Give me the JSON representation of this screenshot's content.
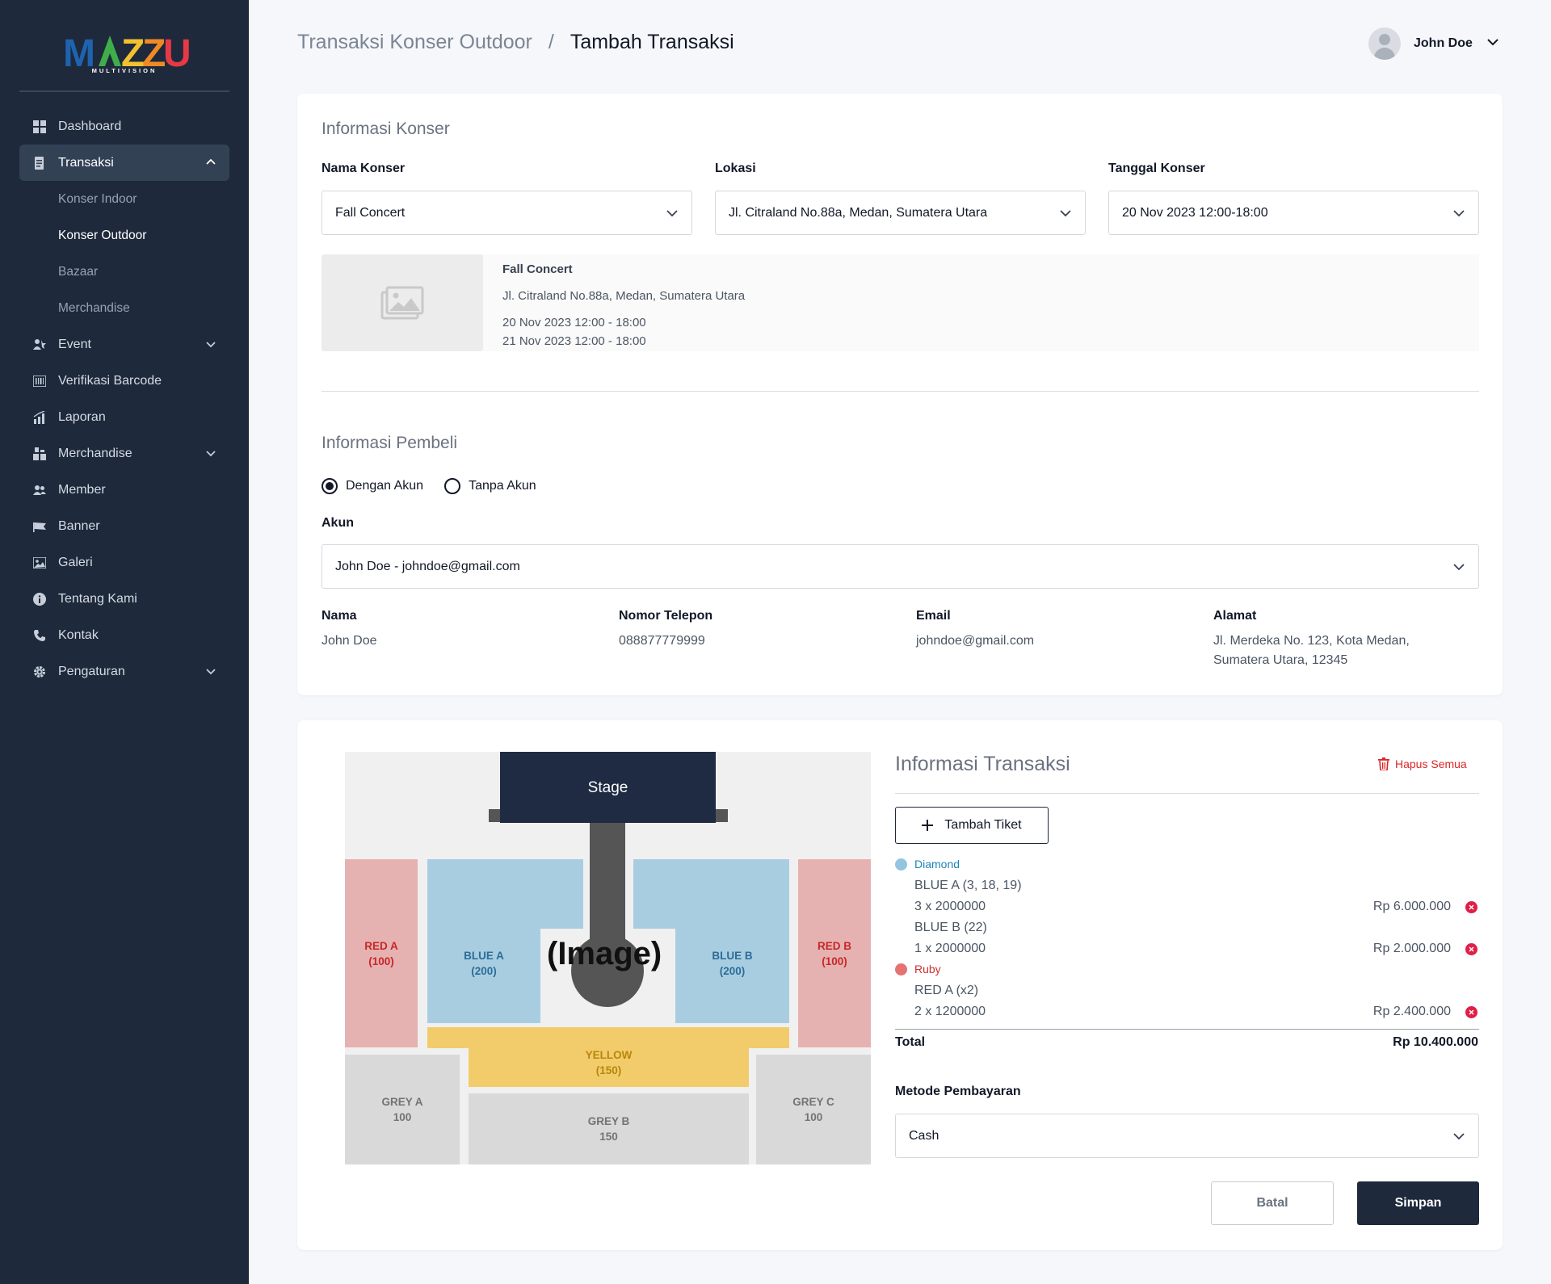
{
  "brand": {
    "logo_text": "MAZZU",
    "logo_sub": "MULTIVISION"
  },
  "sidebar": {
    "items": [
      {
        "label": "Dashboard",
        "icon": "dashboard-icon"
      },
      {
        "label": "Transaksi",
        "icon": "receipt-icon",
        "expanded": true,
        "children": [
          "Konser Indoor",
          "Konser Outdoor",
          "Bazaar",
          "Merchandise"
        ],
        "active_child": "Konser Outdoor"
      },
      {
        "label": "Event",
        "icon": "event-icon",
        "has_children": true
      },
      {
        "label": "Verifikasi Barcode",
        "icon": "barcode-icon"
      },
      {
        "label": "Laporan",
        "icon": "chart-icon"
      },
      {
        "label": "Merchandise",
        "icon": "shop-icon",
        "has_children": true
      },
      {
        "label": "Member",
        "icon": "users-icon"
      },
      {
        "label": "Banner",
        "icon": "flag-icon"
      },
      {
        "label": "Galeri",
        "icon": "gallery-icon"
      },
      {
        "label": "Tentang Kami",
        "icon": "info-icon"
      },
      {
        "label": "Kontak",
        "icon": "phone-icon"
      },
      {
        "label": "Pengaturan",
        "icon": "gear-icon",
        "has_children": true
      }
    ]
  },
  "header": {
    "breadcrumb_parent": "Transaksi Konser Outdoor",
    "breadcrumb_sep": "/",
    "breadcrumb_current": "Tambah Transaksi",
    "user_name": "John Doe"
  },
  "konser": {
    "section_title": "Informasi Konser",
    "nama_label": "Nama Konser",
    "nama_value": "Fall Concert",
    "lokasi_label": "Lokasi",
    "lokasi_value": "Jl. Citraland No.88a, Medan, Sumatera Utara",
    "tanggal_label": "Tanggal Konser",
    "tanggal_value": "20 Nov 2023 12:00-18:00",
    "preview": {
      "name": "Fall Concert",
      "location": "Jl. Citraland No.88a, Medan, Sumatera Utara",
      "date1": "20 Nov 2023 12:00 - 18:00",
      "date2": "21 Nov 2023 12:00 - 18:00"
    }
  },
  "pembeli": {
    "section_title": "Informasi Pembeli",
    "radio_with": "Dengan Akun",
    "radio_without": "Tanpa Akun",
    "selected": "Dengan Akun",
    "akun_label": "Akun",
    "akun_value": "John Doe - johndoe@gmail.com",
    "nama_label": "Nama",
    "nama_value": "John Doe",
    "telepon_label": "Nomor Telepon",
    "telepon_value": "088877779999",
    "email_label": "Email",
    "email_value": "johndoe@gmail.com",
    "alamat_label": "Alamat",
    "alamat_line1": "Jl. Merdeka No. 123, Kota Medan,",
    "alamat_line2": "Sumatera Utara, 12345"
  },
  "seatmap": {
    "stage": "Stage",
    "image_label": "(Image)",
    "red_a": {
      "name": "RED A",
      "cap": "(100)"
    },
    "red_b": {
      "name": "RED B",
      "cap": "(100)"
    },
    "blue_a": {
      "name": "BLUE A",
      "cap": "(200)"
    },
    "blue_b": {
      "name": "BLUE B",
      "cap": "(200)"
    },
    "yellow": {
      "name": "YELLOW",
      "cap": "(150)"
    },
    "grey_a": {
      "name": "GREY A",
      "cap": "100"
    },
    "grey_b": {
      "name": "GREY B",
      "cap": "150"
    },
    "grey_c": {
      "name": "GREY C",
      "cap": "100"
    }
  },
  "transaksi": {
    "title": "Informasi Transaksi",
    "hapus_label": "Hapus Semua",
    "tambah_label": "Tambah Tiket",
    "tiers": [
      {
        "name": "Diamond",
        "color": "#93c5e0",
        "text_color": "#1d84b5",
        "lines": [
          {
            "seats": "BLUE A (3, 18, 19)",
            "qty": "3 x 2000000",
            "price": "Rp 6.000.000"
          },
          {
            "seats": "BLUE B (22)",
            "qty": "1 x 2000000",
            "price": "Rp 2.000.000"
          }
        ]
      },
      {
        "name": "Ruby",
        "color": "#e57373",
        "text_color": "#d32f2f",
        "lines": [
          {
            "seats": "RED A (x2)",
            "qty": "2 x 1200000",
            "price": "Rp 2.400.000"
          }
        ]
      }
    ],
    "total_label": "Total",
    "total_value": "Rp 10.400.000",
    "metode_label": "Metode Pembayaran",
    "metode_value": "Cash",
    "batal_label": "Batal",
    "simpan_label": "Simpan"
  },
  "colors": {
    "sidebar": "#1e293b",
    "primary": "#1e293b",
    "danger": "#dc2626"
  }
}
